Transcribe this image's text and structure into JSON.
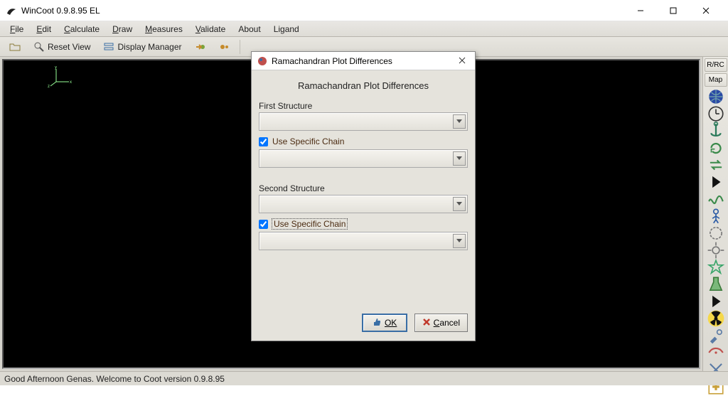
{
  "window": {
    "title": "WinCoot 0.9.8.95 EL"
  },
  "menubar": {
    "items": [
      {
        "label": "File",
        "ul": "F"
      },
      {
        "label": "Edit",
        "ul": "E"
      },
      {
        "label": "Calculate",
        "ul": "C"
      },
      {
        "label": "Draw",
        "ul": "D"
      },
      {
        "label": "Measures",
        "ul": "M"
      },
      {
        "label": "Validate",
        "ul": "V"
      },
      {
        "label": "About",
        "ul": ""
      },
      {
        "label": "Ligand",
        "ul": ""
      }
    ]
  },
  "toolbar": {
    "reset_view": "Reset View",
    "display_manager": "Display Manager"
  },
  "sidepanel": {
    "rrc": "R/RC",
    "map": "Map"
  },
  "statusbar": {
    "text": "Good Afternoon Genas. Welcome to Coot version 0.9.8.95"
  },
  "dialog": {
    "title": "Ramachandran Plot Differences",
    "heading": "Ramachandran Plot Differences",
    "first_label": "First Structure",
    "second_label": "Second Structure",
    "use_specific_chain": "Use Specific Chain",
    "first_chain_checked": true,
    "second_chain_checked": true,
    "ok": "OK",
    "cancel": "Cancel"
  }
}
